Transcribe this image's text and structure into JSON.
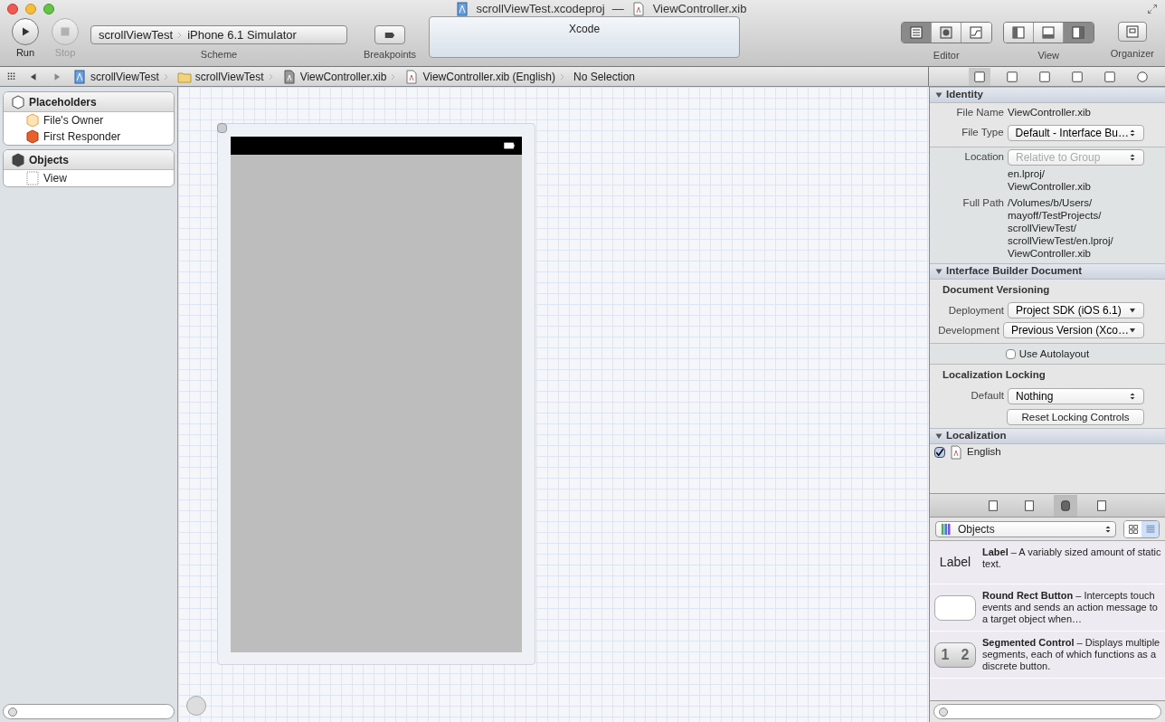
{
  "window": {
    "project_file": "scrollViewTest.xcodeproj",
    "separator": "—",
    "open_file": "ViewController.xib"
  },
  "toolbar": {
    "run": {
      "label": "Run"
    },
    "stop": {
      "label": "Stop",
      "disabled": true
    },
    "scheme": {
      "project": "scrollViewTest",
      "device": "iPhone 6.1 Simulator",
      "label": "Scheme"
    },
    "breakpoints": {
      "label": "Breakpoints"
    },
    "activity": {
      "text": "Xcode"
    },
    "editor": {
      "label": "Editor",
      "segments": [
        {
          "kind": "standard",
          "selected": true
        },
        {
          "kind": "assistant",
          "selected": false
        },
        {
          "kind": "version",
          "selected": false
        }
      ]
    },
    "view": {
      "label": "View",
      "segments": [
        {
          "kind": "left",
          "selected": false
        },
        {
          "kind": "bottom",
          "selected": false
        },
        {
          "kind": "right",
          "selected": true
        }
      ]
    },
    "organizer": {
      "label": "Organizer"
    }
  },
  "jump_bar": [
    {
      "kind": "project",
      "label": "scrollViewTest"
    },
    {
      "kind": "folder",
      "label": "scrollViewTest"
    },
    {
      "kind": "xib",
      "label": "ViewController.xib"
    },
    {
      "kind": "doc",
      "label": "ViewController.xib (English)"
    },
    {
      "kind": "none",
      "label": "No Selection"
    }
  ],
  "outline": [
    {
      "title": "Placeholders",
      "items": [
        {
          "kind": "owner",
          "label": "File's Owner"
        },
        {
          "kind": "responder",
          "label": "First Responder"
        }
      ]
    },
    {
      "title": "Objects",
      "items": [
        {
          "kind": "view",
          "label": "View"
        }
      ]
    }
  ],
  "inspector": {
    "tabs": [
      {
        "kind": "file",
        "selected": true
      },
      {
        "kind": "help",
        "selected": false
      },
      {
        "kind": "identity",
        "selected": false
      },
      {
        "kind": "attributes",
        "selected": false
      },
      {
        "kind": "size",
        "selected": false
      },
      {
        "kind": "connections",
        "selected": false
      }
    ],
    "identity": {
      "title": "Identity",
      "file_name_label": "File Name",
      "file_name": "ViewController.xib",
      "file_type_label": "File Type",
      "file_type": "Default - Interface Bu…",
      "location_label": "Location",
      "location": "Relative to Group",
      "relative_path": [
        "en.lproj/",
        "ViewController.xib"
      ],
      "full_path_label": "Full Path",
      "full_path": [
        "/Volumes/b/Users/",
        "mayoff/TestProjects/",
        "scrollViewTest/",
        "scrollViewTest/en.lproj/",
        "ViewController.xib"
      ]
    },
    "ib_document": {
      "title": "Interface Builder Document",
      "versioning": "Document Versioning",
      "deployment_label": "Deployment",
      "deployment": "Project SDK (iOS 6.1)",
      "development_label": "Development",
      "development": "Previous Version (Xco…",
      "autolayout": {
        "label": "Use Autolayout",
        "checked": false
      },
      "locking": "Localization Locking",
      "default_label": "Default",
      "default": "Nothing",
      "reset": "Reset Locking Controls"
    },
    "localization": {
      "title": "Localization",
      "items": [
        {
          "label": "English",
          "checked": true
        }
      ]
    }
  },
  "library": {
    "tabs": [
      {
        "kind": "file",
        "selected": false
      },
      {
        "kind": "code",
        "selected": false
      },
      {
        "kind": "object",
        "selected": true
      },
      {
        "kind": "media",
        "selected": false
      }
    ],
    "dropdown": "Objects",
    "modes": [
      {
        "kind": "grid",
        "selected": false
      },
      {
        "kind": "list",
        "selected": true
      }
    ],
    "items": [
      {
        "kind": "label",
        "preview": "Label",
        "title": "Label",
        "description": " – A variably sized amount of static text."
      },
      {
        "kind": "button",
        "title": "Round Rect Button",
        "description": " – Intercepts touch events and sends an action message to a target object when…"
      },
      {
        "kind": "segmented",
        "segments": [
          "1",
          "2"
        ],
        "title": "Segmented Control",
        "description": " – Displays multiple segments, each of which functions as a discrete button."
      }
    ]
  }
}
